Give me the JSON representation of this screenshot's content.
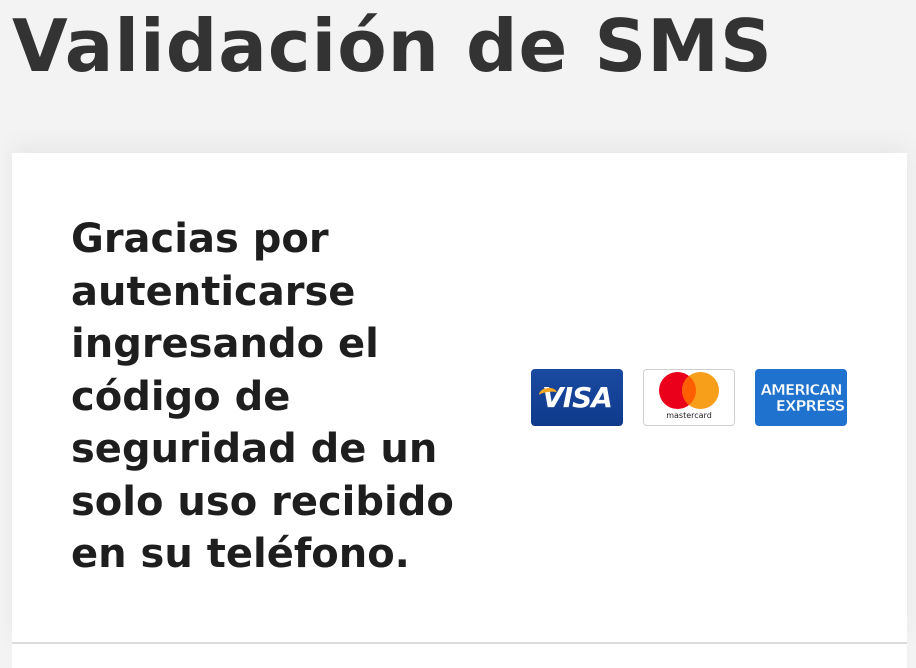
{
  "page": {
    "title": "Validación de SMS"
  },
  "card": {
    "message": "Gracias por autenticarse ingresando el código de seguridad de un solo uso recibido en su teléfono."
  },
  "payment_logos": [
    {
      "icon": "visa-logo",
      "text": "VISA"
    },
    {
      "icon": "mastercard-logo",
      "text": "mastercard"
    },
    {
      "icon": "american-express-logo",
      "line1": "AMERICAN",
      "line2": "EXPRESS"
    }
  ],
  "colors": {
    "background": "#f3f3f3",
    "card": "#ffffff",
    "title_text": "#333333",
    "message_text": "#1e1e1e",
    "visa_blue": "#1a4aa0",
    "mastercard_red": "#eb001b",
    "mastercard_yellow": "#f79e1b",
    "amex_blue": "#1f72cd"
  }
}
